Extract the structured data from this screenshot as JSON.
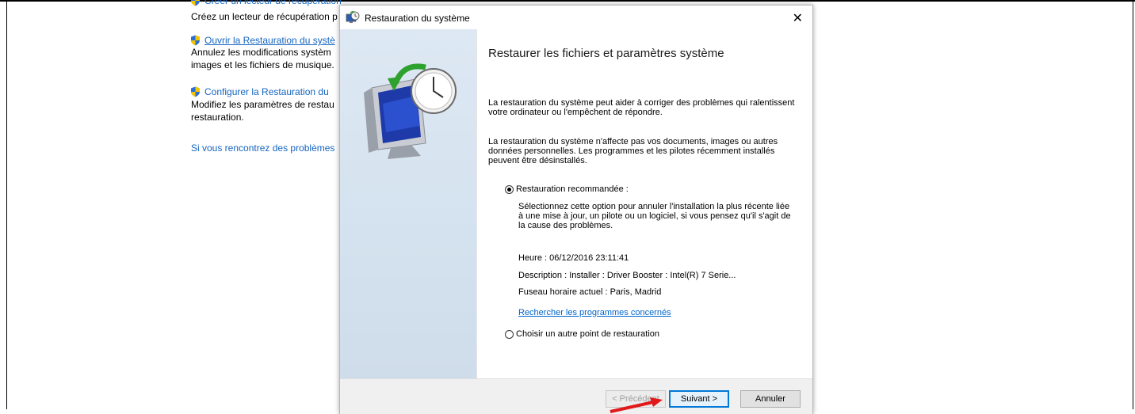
{
  "background": {
    "item1_title": "Créer un lecteur de récupération",
    "item1_desc": "Créez un lecteur de récupération p",
    "item2_title": "Ouvrir la Restauration du systè",
    "item2_desc_line1": "Annulez les modifications systèm",
    "item2_desc_line2": "images et les fichiers de musique.",
    "item3_title": "Configurer la Restauration du",
    "item3_desc_line1": "Modifiez les paramètres de restau",
    "item3_desc_line2": "restauration.",
    "trouble_link": "Si vous rencontrez des problèmes"
  },
  "dialog": {
    "title": "Restauration du système",
    "close_glyph": "✕",
    "heading": "Restaurer les fichiers et paramètres système",
    "para1": "La restauration du système peut aider à corriger des problèmes qui ralentissent votre ordinateur ou l'empêchent de répondre.",
    "para2": "La restauration du système n'affecte pas vos documents, images ou autres données personnelles. Les programmes et les pilotes récemment installés peuvent être désinstallés.",
    "option1_label": "Restauration recommandée :",
    "option1_desc": "Sélectionnez cette option pour annuler l'installation la plus récente liée à une mise à jour, un pilote ou un logiciel, si vous pensez qu'il s'agit de la cause des problèmes.",
    "time": "Heure : 06/12/2016 23:11:41",
    "description": "Description : Installer : Driver Booster : Intel(R) 7 Serie...",
    "timezone": "Fuseau horaire actuel : Paris, Madrid",
    "affected_link": "Rechercher les programmes concernés",
    "option2_label": "Choisir un autre point de restauration",
    "option_selected": "recommended"
  },
  "footer": {
    "prev_label": "< Précédent",
    "next_label": "Suivant >",
    "cancel_label": "Annuler"
  },
  "colors": {
    "link": "#0066cc",
    "accent": "#0078d7",
    "side_panel": "#d4e2ef",
    "arrow": "#e01a1a"
  }
}
